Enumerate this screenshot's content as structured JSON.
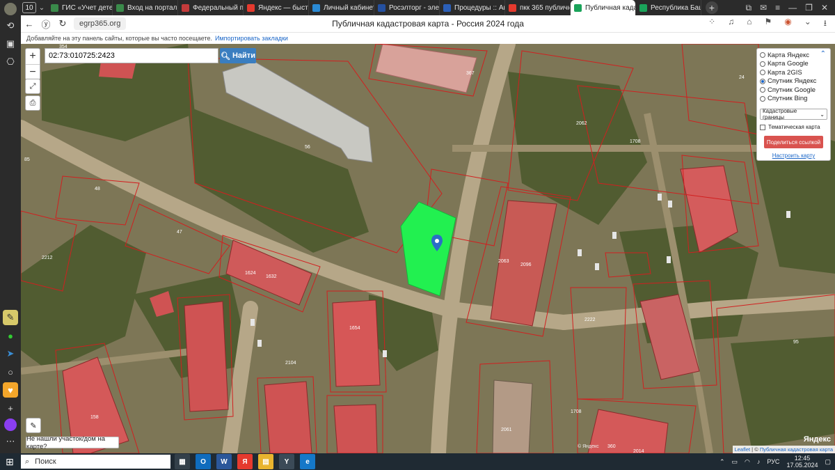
{
  "tabs": {
    "count": "10",
    "items": [
      {
        "label": "ГИС «Учет детей",
        "color": "#3a8a4a"
      },
      {
        "label": "Вход на портал",
        "color": "#3a8a4a"
      },
      {
        "label": "Федеральный по",
        "color": "#c43b3b"
      },
      {
        "label": "Яндекс — быстр",
        "color": "#e53a2e"
      },
      {
        "label": "Личный кабинет",
        "color": "#2a8ad4"
      },
      {
        "label": "Росэлторг - элек",
        "color": "#2450a0"
      },
      {
        "label": "Процедуры :: Ак",
        "color": "#2b5fb8"
      },
      {
        "label": "пкк 365 публичн",
        "color": "#e53a2e"
      },
      {
        "label": "Публичная када",
        "color": "#1aa35a",
        "active": true
      },
      {
        "label": "Республика Башк",
        "color": "#1aa35a"
      }
    ]
  },
  "address": {
    "url": "egrp365.org",
    "page_title": "Публичная кадастровая карта - Россия 2024 года"
  },
  "bookmarks_bar": {
    "hint": "Добавляйте на эту панель сайты, которые вы часто посещаете.",
    "import_link": "Импортировать закладки"
  },
  "map": {
    "search_value": "02:73:010725:2423",
    "search_button": "Найти",
    "zoom_in": "+",
    "zoom_out": "−",
    "layers": {
      "options": [
        {
          "label": "Карта Яндекс",
          "selected": false
        },
        {
          "label": "Карта Google",
          "selected": false
        },
        {
          "label": "Карта 2GIS",
          "selected": false
        },
        {
          "label": "Спутник Яндекс",
          "selected": true
        },
        {
          "label": "Спутник Google",
          "selected": false
        },
        {
          "label": "Спутник Bing",
          "selected": false
        }
      ],
      "overlay_select": "Кадастровые границы",
      "thematic_label": "Тематическая карта",
      "share_button": "Поделиться ссылкой",
      "setup_link": "Настроить карту"
    },
    "not_found_button": "Не нашли участок/дом на карте?",
    "attribution": {
      "leaflet": "Leaflet",
      "separator": " | © ",
      "pkk": "Публичная кадастровая карта"
    },
    "copyright": "© Яндекс",
    "provider_logo": "Яндекс",
    "parcel_labels": [
      "354",
      "367",
      "24",
      "56",
      "2062",
      "1708",
      "48",
      "85",
      "47",
      "2212",
      "1624",
      "1632",
      "2063",
      "2096",
      "1654",
      "2222",
      "2061",
      "1708",
      "158",
      "2104",
      "360",
      "2014",
      "95"
    ]
  },
  "taskbar": {
    "search_placeholder": "Поиск",
    "apps": [
      {
        "label": "▦",
        "color": "#33404a"
      },
      {
        "label": "O",
        "color": "#0f6cbd"
      },
      {
        "label": "W",
        "color": "#2b579a"
      },
      {
        "label": "Я",
        "color": "#e53a2e"
      },
      {
        "label": "▤",
        "color": "#e8b42e"
      },
      {
        "label": "Y",
        "color": "#3b4a57"
      },
      {
        "label": "e",
        "color": "#1578c8"
      }
    ],
    "lang": "РУС",
    "time": "12:45",
    "date": "17.05.2024"
  }
}
